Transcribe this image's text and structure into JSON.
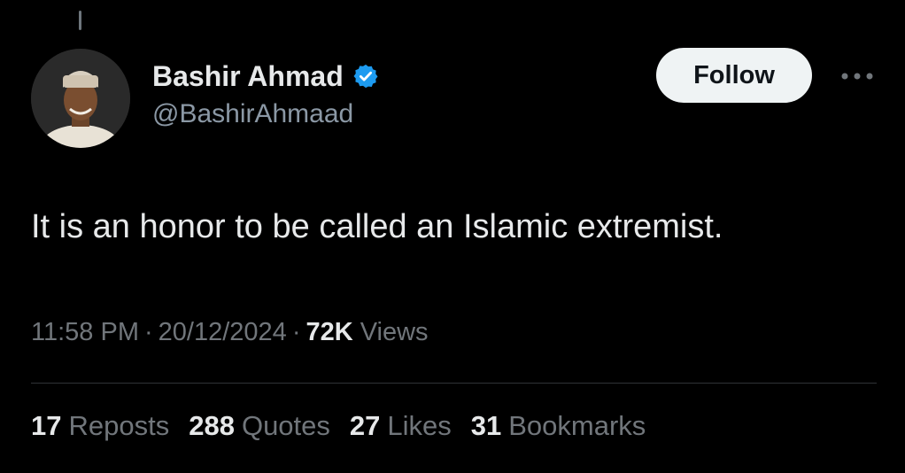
{
  "author": {
    "display_name": "Bashir Ahmad",
    "handle": "@BashirAhmaad",
    "verified": true,
    "avatar_icon": "profile-photo"
  },
  "actions": {
    "follow_label": "Follow",
    "more_icon": "more-horizontal-icon"
  },
  "tweet": {
    "text": "It is an honor to be called an Islamic extremist."
  },
  "meta": {
    "time": "11:58 PM",
    "separator": "·",
    "date": "20/12/2024",
    "views_count": "72K",
    "views_label": "Views"
  },
  "stats": [
    {
      "count": "17",
      "label": "Reposts"
    },
    {
      "count": "288",
      "label": "Quotes"
    },
    {
      "count": "27",
      "label": "Likes"
    },
    {
      "count": "31",
      "label": "Bookmarks"
    }
  ],
  "colors": {
    "background": "#000000",
    "primary_text": "#e7e9ea",
    "secondary_text": "#71767b",
    "verified_blue": "#1d9bf0",
    "divider": "#2f3336"
  }
}
